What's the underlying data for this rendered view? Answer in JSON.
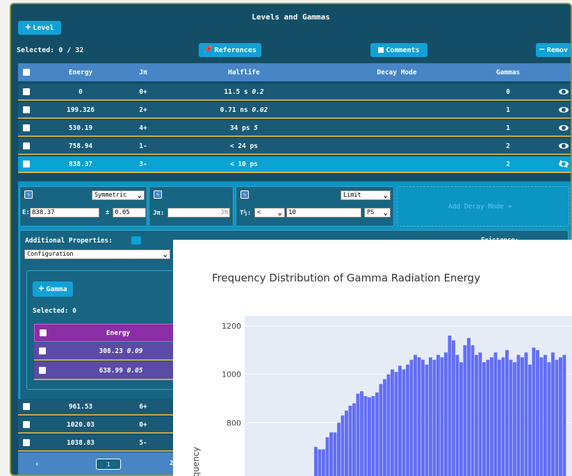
{
  "header": {
    "title": "Levels and Gammas",
    "add_level_label": "Level"
  },
  "toolbar": {
    "selected": "Selected: 0 / 32",
    "references": "References",
    "comments": "Comments",
    "remove": "Remov"
  },
  "levels": {
    "columns": [
      "Energy",
      "Jπ",
      "Halflife",
      "Decay Mode",
      "Gammas"
    ],
    "rows": [
      {
        "energy": "0",
        "jpi": "0+",
        "halflife": "11.5 s",
        "unc": "0.2",
        "gammas": "0"
      },
      {
        "energy": "199.326",
        "jpi": "2+",
        "halflife": "0.71 ns",
        "unc": "0.02",
        "gammas": "1"
      },
      {
        "energy": "530.19",
        "jpi": "4+",
        "halflife": "34 ps",
        "unc": "5",
        "gammas": "1"
      },
      {
        "energy": "758.94",
        "jpi": "1-",
        "halflife": "< 24 ps",
        "unc": "",
        "gammas": "2"
      },
      {
        "energy": "838.37",
        "jpi": "3-",
        "halflife": "< 10 ps",
        "unc": "",
        "gammas": "2"
      }
    ],
    "rows_after": [
      {
        "energy": "961.53",
        "jpi": "6+"
      },
      {
        "energy": "1020.03",
        "jpi": "0+"
      },
      {
        "energy": "1038.83",
        "jpi": "5-"
      }
    ]
  },
  "editor": {
    "energy_mode": "Symmetric",
    "energy_label": "E:",
    "energy_value": "838.37",
    "pm": "±",
    "energy_unc": "0.05",
    "jpi_label": "Jπ:",
    "jpi_placeholder": "Jπ",
    "limit_mode": "Limit",
    "t_label": "T½:",
    "t_op": "<",
    "t_value": "10",
    "t_unit": "PS",
    "add_decay_mode": "Add Decay Mode +",
    "additional_properties": "Additional Properties:",
    "config_select": "Configuration",
    "existance": "Existance:"
  },
  "gammas": {
    "add_label": "Gamma",
    "selected": "Selected: 0",
    "header": "Energy",
    "rows": [
      {
        "energy": "308.23",
        "unc": "0.09"
      },
      {
        "energy": "638.99",
        "unc": "0.05"
      }
    ]
  },
  "pager": {
    "page1": "1",
    "page2": "2"
  },
  "chart_data": {
    "type": "bar",
    "title": "Frequency Distribution of Gamma Radiation Energy",
    "ylabel": "Frequency",
    "ylim": [
      580,
      1240
    ],
    "yticks": [
      800,
      1000,
      1200
    ],
    "values": [
      700,
      690,
      690,
      740,
      760,
      760,
      800,
      830,
      850,
      870,
      880,
      920,
      930,
      910,
      905,
      910,
      925,
      960,
      980,
      1000,
      1020,
      1010,
      1035,
      1020,
      1040,
      1060,
      1080,
      1070,
      1060,
      1040,
      1070,
      1060,
      1080,
      1070,
      1090,
      1160,
      1140,
      1080,
      1050,
      1120,
      1150,
      1120,
      1080,
      1090,
      1050,
      1060,
      1070,
      1090,
      1060,
      1070,
      1100,
      1060,
      1050,
      1080,
      1070,
      1090,
      1040,
      1110,
      1100,
      1070,
      1080,
      1050,
      1090,
      1060,
      1070,
      1080
    ],
    "bar_color": "#636efa",
    "plot_bg": "#e5ecf6"
  }
}
